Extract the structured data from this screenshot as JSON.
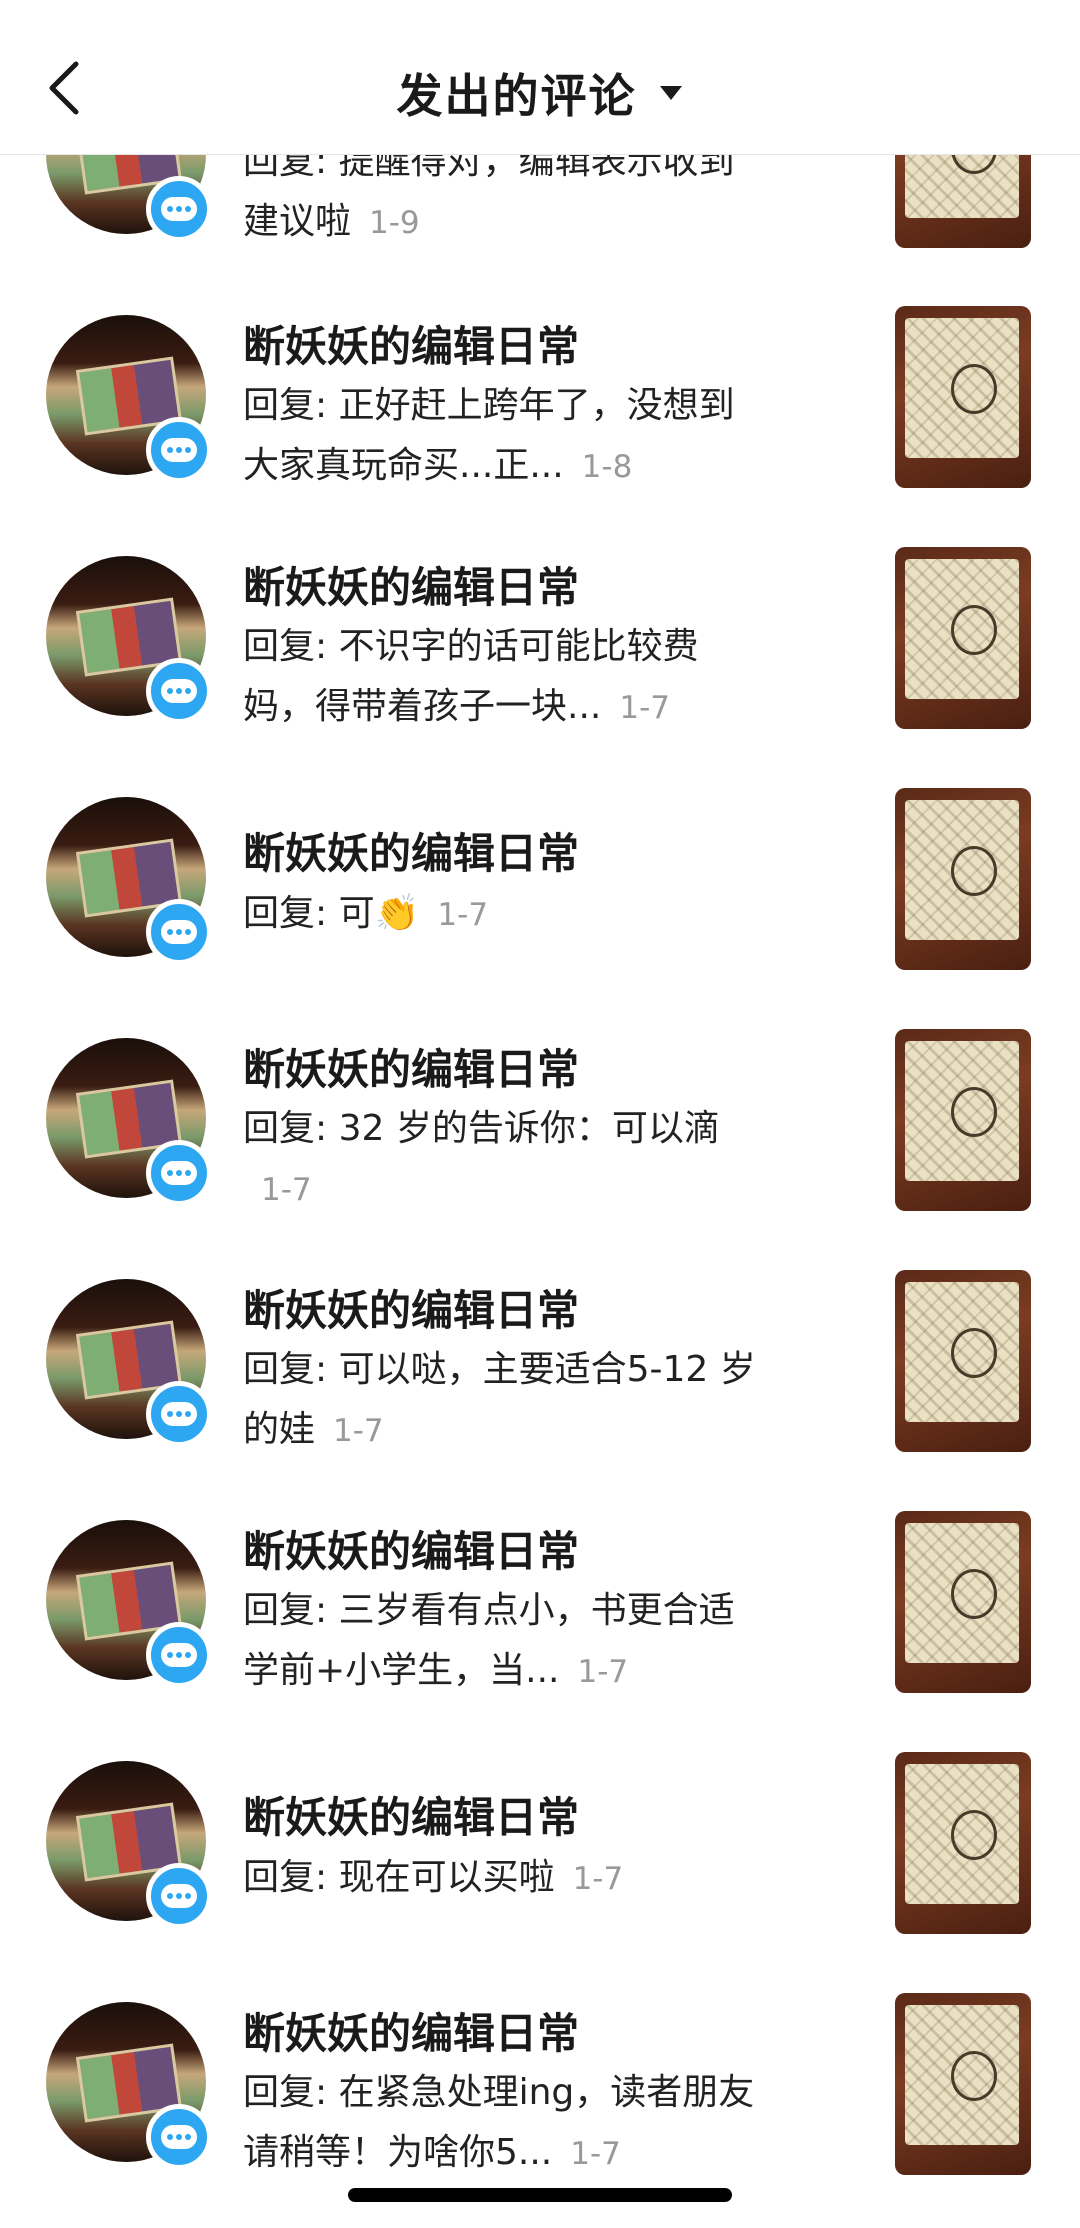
{
  "header": {
    "title": "发出的评论"
  },
  "comments": [
    {
      "name": "",
      "text": "回复: 提醒得对，编辑表示收到建议啦",
      "date": "1-9"
    },
    {
      "name": "断妖妖的编辑日常",
      "text": "回复: 正好赶上跨年了，没想到大家真玩命买...正...",
      "date": "1-8"
    },
    {
      "name": "断妖妖的编辑日常",
      "text": "回复: 不识字的话可能比较费妈，得带着孩子一块...",
      "date": "1-7"
    },
    {
      "name": "断妖妖的编辑日常",
      "text": "回复: 可👏",
      "date": "1-7"
    },
    {
      "name": "断妖妖的编辑日常",
      "text": "回复: 32 岁的告诉你：可以滴",
      "date": "1-7"
    },
    {
      "name": "断妖妖的编辑日常",
      "text": "回复: 可以哒，主要适合5-12 岁的娃",
      "date": "1-7"
    },
    {
      "name": "断妖妖的编辑日常",
      "text": "回复: 三岁看有点小，书更合适学前+小学生，当...",
      "date": "1-7"
    },
    {
      "name": "断妖妖的编辑日常",
      "text": "回复: 现在可以买啦",
      "date": "1-7"
    },
    {
      "name": "断妖妖的编辑日常",
      "text": "回复: 在紧急处理ing，读者朋友请稍等！为啥你5...",
      "date": "1-7"
    }
  ]
}
